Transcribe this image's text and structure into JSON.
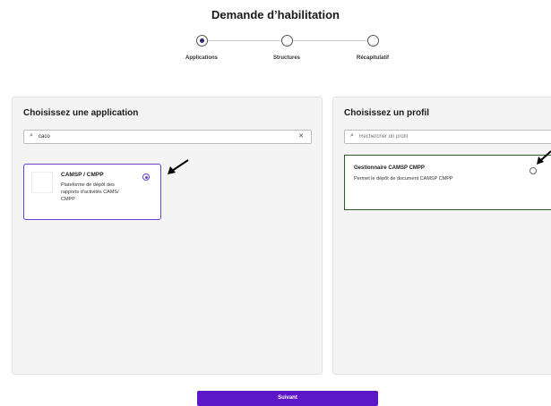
{
  "page": {
    "title": "Demande d’habilitation"
  },
  "stepper": {
    "steps": [
      {
        "label": "Applications",
        "active": true
      },
      {
        "label": "Structures",
        "active": false
      },
      {
        "label": "Récapitulatif",
        "active": false
      }
    ]
  },
  "application_panel": {
    "title": "Choisissez une application",
    "search": {
      "value": "caco",
      "placeholder": ""
    },
    "items": [
      {
        "name": "CAMSP / CMPP",
        "description": "Plateforme de dépôt des rapports d'activités CAMS/ CMPP",
        "selected": true
      }
    ]
  },
  "profile_panel": {
    "title": "Choisissez un profil",
    "search": {
      "value": "",
      "placeholder": "Rechercher un profil"
    },
    "items": [
      {
        "name": "Gestionnaire CAMSP CMPP",
        "description": "Permet le dépôt de document CAMSP CMPP",
        "selected": false
      }
    ]
  },
  "footer": {
    "next_label": "Suivant"
  },
  "colors": {
    "accent": "#5c17c9",
    "selection": "#6d3fd0",
    "highlight_border": "#2e5b2e"
  },
  "icons": {
    "search": "search-icon",
    "clear": "close-icon",
    "annotation": "arrow-icon"
  }
}
